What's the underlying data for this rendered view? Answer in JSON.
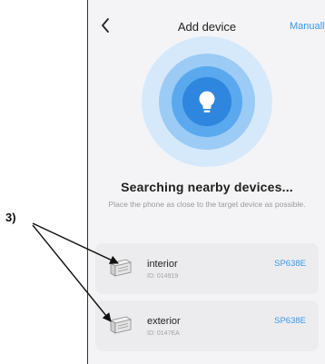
{
  "callout": {
    "label": "3)"
  },
  "header": {
    "title": "Add device",
    "manual_label": "Manually"
  },
  "scan": {
    "icon": "lightbulb-icon",
    "heading": "Searching nearby devices...",
    "subtext": "Place the phone as close to the target device as possible."
  },
  "devices": [
    {
      "name": "interior",
      "id": "ID: 014919",
      "model": "SP638E"
    },
    {
      "name": "exterior",
      "id": "ID: 0147EA",
      "model": "SP638E"
    }
  ],
  "colors": {
    "accent": "#3a98ea",
    "ring_outer": "#d6e9fb",
    "ring_mid": "#9ccbf5",
    "ring_inner": "#5aa9ef",
    "core": "#2f86de"
  }
}
